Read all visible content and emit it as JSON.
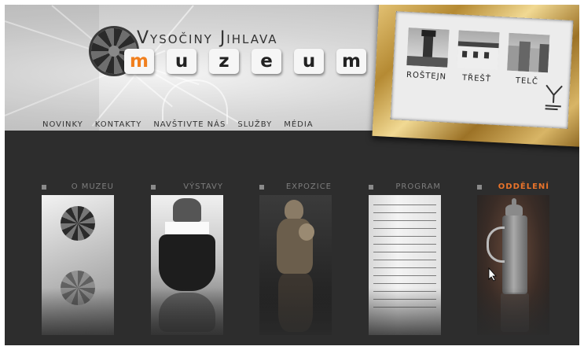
{
  "header": {
    "title_top": "Vysočiny Jihlava",
    "logo_letters": [
      "m",
      "u",
      "z",
      "e",
      "u",
      "m"
    ],
    "accent_color": "#f07f1e",
    "nav": [
      "NOVINKY",
      "KONTAKTY",
      "NAVŠTIVTE NÁS",
      "SLUŽBY",
      "MÉDIA"
    ]
  },
  "branches": [
    {
      "label": "ROŠTEJN",
      "icon": "castle-tower-photo"
    },
    {
      "label": "TŘEŠŤ",
      "icon": "building-photo"
    },
    {
      "label": "TELČ",
      "icon": "square-houses-photo"
    }
  ],
  "sections": [
    {
      "label": "O MUZEU",
      "active": false,
      "icon": "vault-rosette-photo"
    },
    {
      "label": "VÝSTAVY",
      "active": false,
      "icon": "folk-costume-photo"
    },
    {
      "label": "EXPOZICE",
      "active": false,
      "icon": "madonna-statue-photo"
    },
    {
      "label": "PROGRAM",
      "active": false,
      "icon": "manuscript-photo"
    },
    {
      "label": "ODDĚLENÍ",
      "active": true,
      "icon": "pewter-jug-photo"
    }
  ],
  "colors": {
    "background": "#2d2d2d",
    "gold": "#c9a04a"
  }
}
